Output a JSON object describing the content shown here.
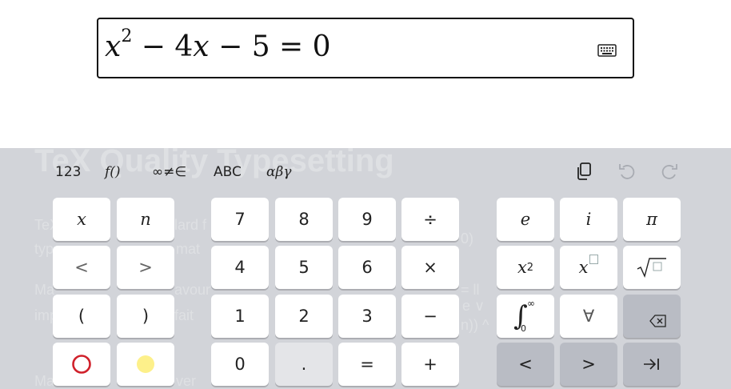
{
  "math_field": {
    "expression": {
      "var": "x",
      "exp": "2",
      "op1": "−",
      "coef": "4",
      "op2": "−",
      "const": "5",
      "eq": "=",
      "rhs": "0"
    },
    "keyboard_toggle_icon": "keyboard-icon"
  },
  "background_doc": {
    "title": "TeX Quality Typesetting",
    "lines": [
      "TeX",
      "lard f",
      "type",
      "mat",
      "0)",
      "Ma",
      "avour",
      "= ll",
      "imp",
      "fait",
      "e ∨",
      "n)) ^",
      "Ma",
      "ver"
    ]
  },
  "tabs": [
    "123",
    "f()",
    "∞≠∈",
    "ABC",
    "αβγ"
  ],
  "toolbar": {
    "copy_icon": "copy-icon",
    "undo_icon": "undo-icon",
    "redo_icon": "redo-icon"
  },
  "keys": {
    "x": "x",
    "n": "n",
    "lt": "<",
    "gt": ">",
    "lparen": "(",
    "rparen": ")",
    "circle_icon": "red-circle-icon",
    "dot_icon": "yellow-dot-icon",
    "d7": "7",
    "d8": "8",
    "d9": "9",
    "div": "÷",
    "d4": "4",
    "d5": "5",
    "d6": "6",
    "mul": "×",
    "d1": "1",
    "d2": "2",
    "d3": "3",
    "minus": "−",
    "d0": "0",
    "point": ".",
    "equals": "=",
    "plus": "+",
    "e": "e",
    "i": "i",
    "pi": "π",
    "sq_base": "x",
    "sq_exp": "2",
    "pow_base": "x",
    "sqrt_icon": "square-root-icon",
    "int_upper": "∞",
    "int_lower": "0",
    "forall": "∀",
    "backspace_icon": "backspace-icon",
    "left": "<",
    "right": ">",
    "tab_icon": "tab-arrow-icon"
  }
}
